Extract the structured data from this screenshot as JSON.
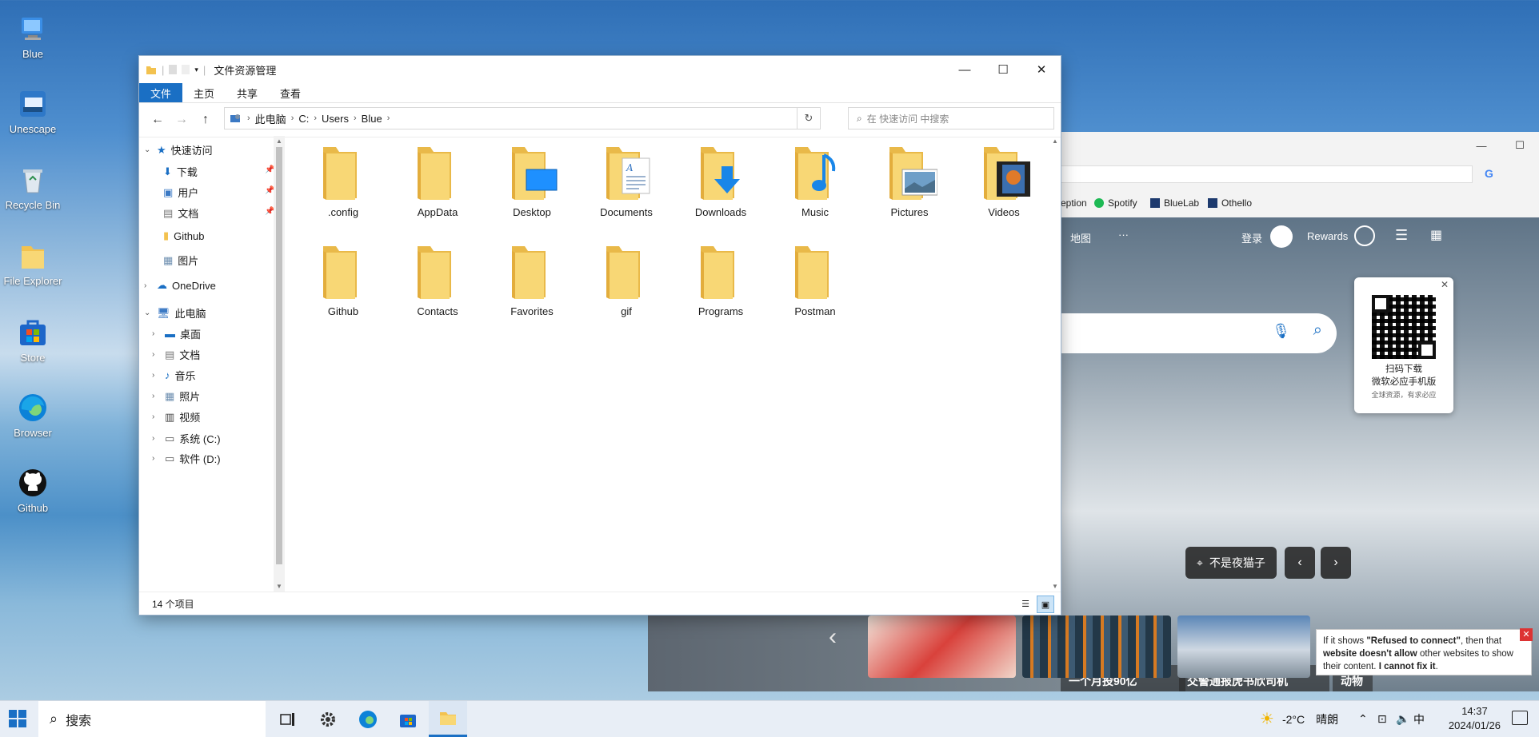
{
  "desktop": {
    "icons": [
      {
        "label": "Blue"
      },
      {
        "label": "Unescape"
      },
      {
        "label": "Recycle Bin"
      },
      {
        "label": "File Explorer"
      },
      {
        "label": "Store"
      },
      {
        "label": "Browser"
      },
      {
        "label": "Github"
      }
    ]
  },
  "explorer": {
    "title": "文件资源管理",
    "ribbon_tabs": [
      "文件",
      "主页",
      "共享",
      "查看"
    ],
    "address": {
      "crumbs": [
        "此电脑",
        "C:",
        "Users",
        "Blue"
      ]
    },
    "search_placeholder": "在 快速访问 中搜索",
    "nav": {
      "quick_access": "快速访问",
      "quick_items": [
        "下载",
        "用户",
        "文档",
        "Github",
        "图片"
      ],
      "onedrive": "OneDrive",
      "this_pc": "此电脑",
      "pc_items": [
        "桌面",
        "文档",
        "音乐",
        "照片",
        "视频",
        "系统 (C:)",
        "软件 (D:)"
      ]
    },
    "folders": [
      {
        "name": ".config",
        "overlay": "none"
      },
      {
        "name": "AppData",
        "overlay": "none"
      },
      {
        "name": "Desktop",
        "overlay": "desktop"
      },
      {
        "name": "Documents",
        "overlay": "document"
      },
      {
        "name": "Downloads",
        "overlay": "download-arrow"
      },
      {
        "name": "Music",
        "overlay": "music-note"
      },
      {
        "name": "Pictures",
        "overlay": "picture"
      },
      {
        "name": "Videos",
        "overlay": "film"
      },
      {
        "name": "Github",
        "overlay": "none"
      },
      {
        "name": "Contacts",
        "overlay": "none"
      },
      {
        "name": "Favorites",
        "overlay": "none"
      },
      {
        "name": "gif",
        "overlay": "none"
      },
      {
        "name": "Programs",
        "overlay": "none"
      },
      {
        "name": "Postman",
        "overlay": "none"
      }
    ],
    "status_count": "14 个项目"
  },
  "browser": {
    "bookmarks": [
      "eption",
      "Spotify",
      "BlueLab",
      "Othello"
    ],
    "header": {
      "maps": "地图",
      "more": "···",
      "login": "登录",
      "rewards": "Rewards"
    },
    "qr_card": {
      "line1": "扫码下载",
      "line2": "微软必应手机版",
      "line3": "全球资源，有求必应"
    },
    "location_label": "不是夜猫子",
    "news": [
      "一个月投90亿",
      "交警通报虎书欣司机",
      "动物"
    ],
    "tooltip": {
      "p1": "If it shows ",
      "b1": "\"Refused to connect\"",
      "p2": ", then that ",
      "b2": "website doesn't allow",
      "p3": " other websites to show their content. ",
      "b3": "I cannot fix it",
      "p4": "."
    }
  },
  "taskbar": {
    "search_label": "搜索",
    "weather_temp": "-2°C",
    "weather_text": "晴朗",
    "ime": "中",
    "time": "14:37",
    "date": "2024/01/26"
  },
  "colors": {
    "accent": "#1a6fc4",
    "folder_yellow": "#f8d775",
    "folder_dark": "#e9b949"
  }
}
